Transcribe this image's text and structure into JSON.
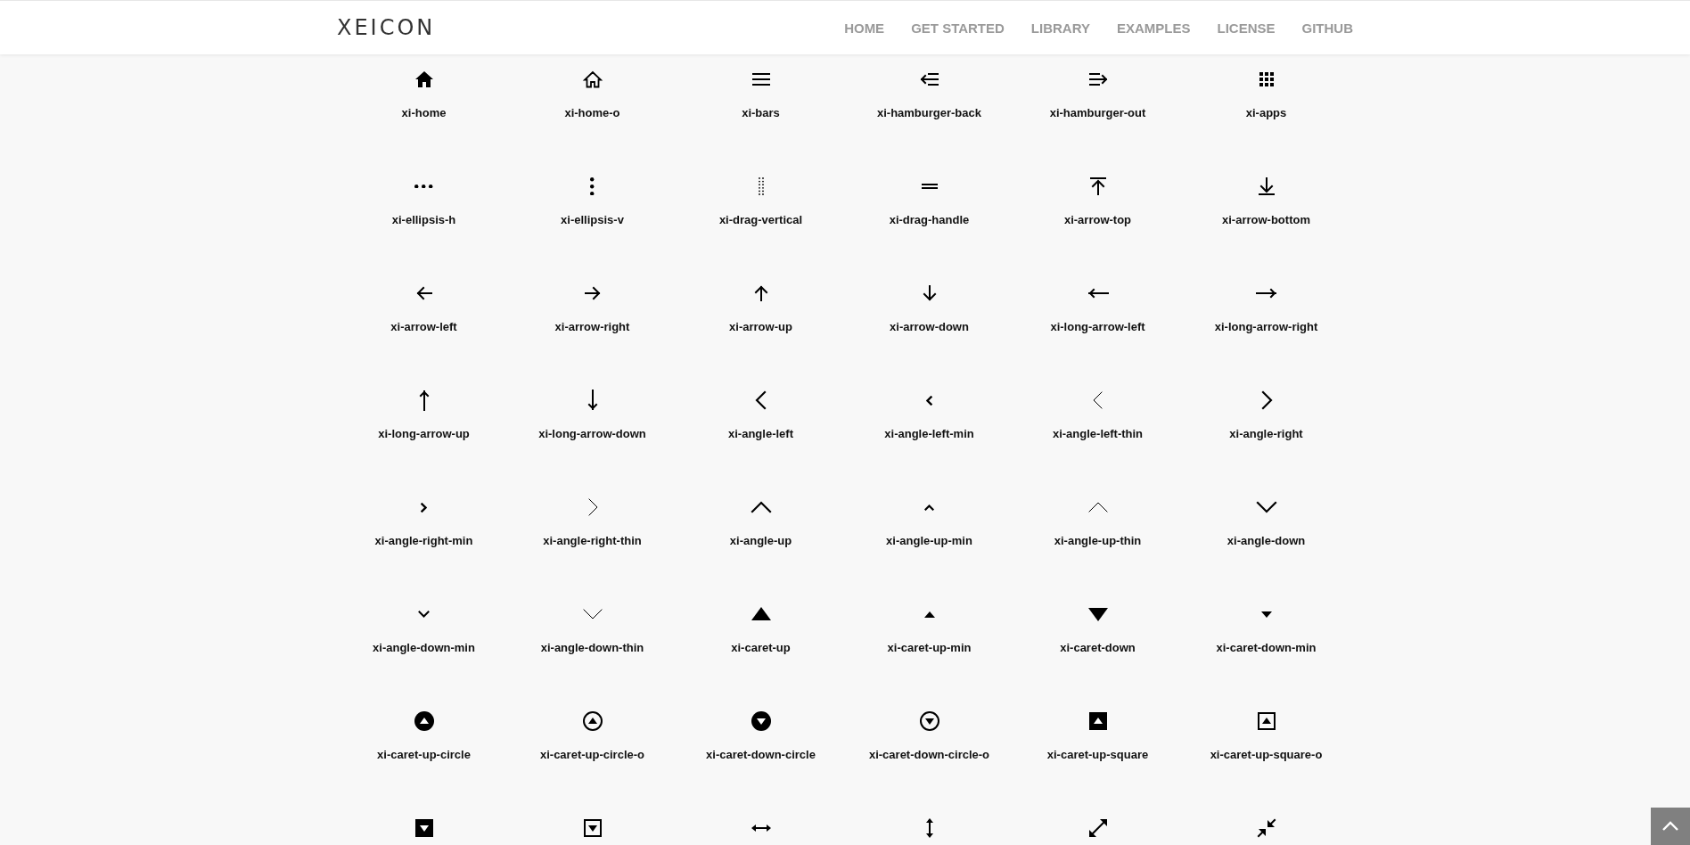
{
  "header": {
    "logo": "XEICON",
    "nav": [
      "HOME",
      "GET STARTED",
      "LIBRARY",
      "EXAMPLES",
      "LICENSE",
      "GITHUB"
    ]
  },
  "icons": [
    {
      "kind": "labeled",
      "label": "xi-home"
    },
    {
      "kind": "labeled",
      "label": "xi-home-o"
    },
    {
      "kind": "labeled",
      "label": "xi-bars"
    },
    {
      "kind": "labeled",
      "label": "xi-hamburger-back"
    },
    {
      "kind": "labeled",
      "label": "xi-hamburger-out"
    },
    {
      "kind": "labeled",
      "label": "xi-apps"
    },
    {
      "kind": "labeled",
      "label": "xi-ellipsis-h"
    },
    {
      "kind": "labeled",
      "label": "xi-ellipsis-v"
    },
    {
      "kind": "labeled",
      "label": "xi-drag-vertical"
    },
    {
      "kind": "labeled",
      "label": "xi-drag-handle"
    },
    {
      "kind": "labeled",
      "label": "xi-arrow-top"
    },
    {
      "kind": "labeled",
      "label": "xi-arrow-bottom"
    },
    {
      "kind": "labeled",
      "label": "xi-arrow-left"
    },
    {
      "kind": "labeled",
      "label": "xi-arrow-right"
    },
    {
      "kind": "labeled",
      "label": "xi-arrow-up"
    },
    {
      "kind": "labeled",
      "label": "xi-arrow-down"
    },
    {
      "kind": "labeled",
      "label": "xi-long-arrow-left"
    },
    {
      "kind": "labeled",
      "label": "xi-long-arrow-right"
    },
    {
      "kind": "labeled",
      "label": "xi-long-arrow-up"
    },
    {
      "kind": "labeled",
      "label": "xi-long-arrow-down"
    },
    {
      "kind": "labeled",
      "label": "xi-angle-left"
    },
    {
      "kind": "labeled",
      "label": "xi-angle-left-min"
    },
    {
      "kind": "labeled",
      "label": "xi-angle-left-thin"
    },
    {
      "kind": "labeled",
      "label": "xi-angle-right"
    },
    {
      "kind": "labeled",
      "label": "xi-angle-right-min"
    },
    {
      "kind": "labeled",
      "label": "xi-angle-right-thin"
    },
    {
      "kind": "labeled",
      "label": "xi-angle-up"
    },
    {
      "kind": "labeled",
      "label": "xi-angle-up-min"
    },
    {
      "kind": "labeled",
      "label": "xi-angle-up-thin"
    },
    {
      "kind": "labeled",
      "label": "xi-angle-down"
    },
    {
      "kind": "labeled",
      "label": "xi-angle-down-min"
    },
    {
      "kind": "labeled",
      "label": "xi-angle-down-thin"
    },
    {
      "kind": "labeled",
      "label": "xi-caret-up"
    },
    {
      "kind": "labeled",
      "label": "xi-caret-up-min"
    },
    {
      "kind": "labeled",
      "label": "xi-caret-down"
    },
    {
      "kind": "labeled",
      "label": "xi-caret-down-min"
    },
    {
      "kind": "labeled",
      "label": "xi-caret-up-circle"
    },
    {
      "kind": "labeled",
      "label": "xi-caret-up-circle-o"
    },
    {
      "kind": "labeled",
      "label": "xi-caret-down-circle"
    },
    {
      "kind": "labeled",
      "label": "xi-caret-down-circle-o"
    },
    {
      "kind": "labeled",
      "label": "xi-caret-up-square"
    },
    {
      "kind": "labeled",
      "label": "xi-caret-up-square-o"
    },
    {
      "kind": "icon-only"
    },
    {
      "kind": "icon-only"
    },
    {
      "kind": "icon-only"
    },
    {
      "kind": "icon-only"
    },
    {
      "kind": "icon-only"
    },
    {
      "kind": "icon-only"
    }
  ]
}
